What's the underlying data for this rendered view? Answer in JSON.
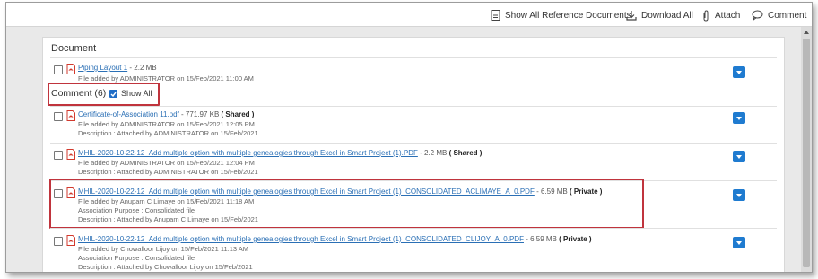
{
  "toolbar": {
    "show_all_ref_docs": "Show All Reference Documents",
    "download_all": "Download All",
    "attach": "Attach",
    "comment": "Comment"
  },
  "document_section": {
    "title": "Document",
    "items": [
      {
        "name": "Piping Layout 1",
        "size": "- 2.2 MB",
        "added": "File added by ADMINISTRATOR on 15/Feb/2021 11:00 AM"
      }
    ]
  },
  "comment_section": {
    "title": "Comment (6)",
    "show_all_label": "Show All",
    "items": [
      {
        "name": "Certificate-of-Association 11.pdf",
        "size": "- 771.97 KB",
        "tag": "( Shared )",
        "added": "File added by ADMINISTRATOR on 15/Feb/2021 12:05 PM",
        "description": "Description : Attached by ADMINISTRATOR on 15/Feb/2021"
      },
      {
        "name": "MHIL-2020-10-22-12_Add multiple option with multiple genealogies through Excel in Smart Project (1).PDF",
        "size": "- 2.2 MB",
        "tag": "( Shared )",
        "added": "File added by ADMINISTRATOR on 15/Feb/2021 12:04 PM",
        "description": "Description : Attached by ADMINISTRATOR on 15/Feb/2021"
      },
      {
        "name": "MHIL-2020-10-22-12_Add multiple option with multiple genealogies through Excel in Smart Project (1)_CONSOLIDATED_ACLIMAYE_A_0.PDF",
        "size": "- 6.59 MB",
        "tag": "( Private )",
        "added": "File added by Anupam C Limaye on 15/Feb/2021 11:18 AM",
        "purpose": "Association Purpose : Consolidated file",
        "description": "Description : Attached by Anupam C Limaye on 15/Feb/2021"
      },
      {
        "name": "MHIL-2020-10-22-12_Add multiple option with multiple genealogies through Excel in Smart Project (1)_CONSOLIDATED_CLIJOY_A_0.PDF",
        "size": "- 6.59 MB",
        "tag": "( Private )",
        "added": "File added by Chowalloor Lijoy on 15/Feb/2021 11:13 AM",
        "purpose": "Association Purpose : Consolidated file",
        "description": "Description : Attached by Chowalloor Lijoy on 15/Feb/2021"
      }
    ]
  },
  "colors": {
    "accent": "#1f7bd0",
    "link": "#2a6fb5",
    "highlight_box": "#c0343d",
    "pdf_red": "#d23a2e"
  }
}
